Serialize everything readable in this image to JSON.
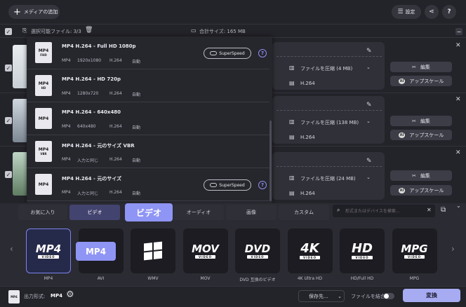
{
  "toolbar": {
    "add_media": "メディアの追加",
    "settings": "設定",
    "help": "?"
  },
  "filebar": {
    "selected": "選択可能ファイル: 3/3",
    "total_size": "合計サイズ: 165 MB"
  },
  "files": [
    {
      "compress": "ファイルを圧縮 (4 MB)",
      "codec": "H.264",
      "edit": "編集",
      "upscale": "アップスケール"
    },
    {
      "compress": "ファイルを圧縮 (138 MB)",
      "codec": "H.264",
      "edit": "編集",
      "upscale": "アップスケール"
    },
    {
      "compress": "ファイルを圧縮 (24 MB)",
      "codec": "H.264",
      "edit": "編集",
      "upscale": "アップスケール"
    }
  ],
  "presets": [
    {
      "title": "MP4 H.264 - Full HD 1080p",
      "fmt": "MP4",
      "res": "1920x1080",
      "codec": "H.264",
      "auto": "自動",
      "superspeed": "SuperSpeed",
      "icon_sub": "FHD"
    },
    {
      "title": "MP4 H.264 - HD 720p",
      "fmt": "MP4",
      "res": "1280x720",
      "codec": "H.264",
      "auto": "自動",
      "superspeed": "",
      "icon_sub": "HD"
    },
    {
      "title": "MP4 H.264 - 640x480",
      "fmt": "MP4",
      "res": "640x480",
      "codec": "H.264",
      "auto": "自動",
      "superspeed": "",
      "icon_sub": ""
    },
    {
      "title": "MP4 H.264 - 元のサイズ VBR",
      "fmt": "MP4",
      "res": "入力と同じ",
      "codec": "H.264",
      "auto": "自動",
      "superspeed": "",
      "icon_sub": "VBR"
    },
    {
      "title": "MP4 H.264 - 元のサイズ",
      "fmt": "MP4",
      "res": "入力と同じ",
      "codec": "H.264",
      "auto": "自動",
      "superspeed": "SuperSpeed",
      "icon_sub": ""
    }
  ],
  "tabs": [
    "お気に入り",
    "ビデオ",
    "オーディオ",
    "画像",
    "カスタム"
  ],
  "search_placeholder": "形式またはデバイスを検索...",
  "callouts": {
    "video": "ビデオ",
    "mp4": "MP4"
  },
  "formats": [
    {
      "logo": "MP4",
      "sub": "VIDEO",
      "caption": "MP4"
    },
    {
      "logo": "AVI",
      "sub": "",
      "caption": "AVI"
    },
    {
      "logo": "",
      "sub": "",
      "caption": "WMV"
    },
    {
      "logo": "MOV",
      "sub": "VIDEO",
      "caption": "MOV"
    },
    {
      "logo": "DVD",
      "sub": "VIDEO",
      "caption": "DVD 互換のビデオ"
    },
    {
      "logo": "4K",
      "sub": "VIDEO",
      "caption": "4K Ultra HD"
    },
    {
      "logo": "HD",
      "sub": "VIDEO",
      "caption": "HD/Full HD"
    },
    {
      "logo": "MPG",
      "sub": "VIDEO",
      "caption": "MPG"
    }
  ],
  "bottom": {
    "output_label": "出力形式:",
    "output_value": "MP4",
    "save_to": "保存先...",
    "merge": "ファイルを結合:",
    "convert": "変換"
  },
  "colors": {
    "accent": "#8f95f5",
    "convert_bg": "#a7abf2",
    "bg": "#23232a"
  }
}
